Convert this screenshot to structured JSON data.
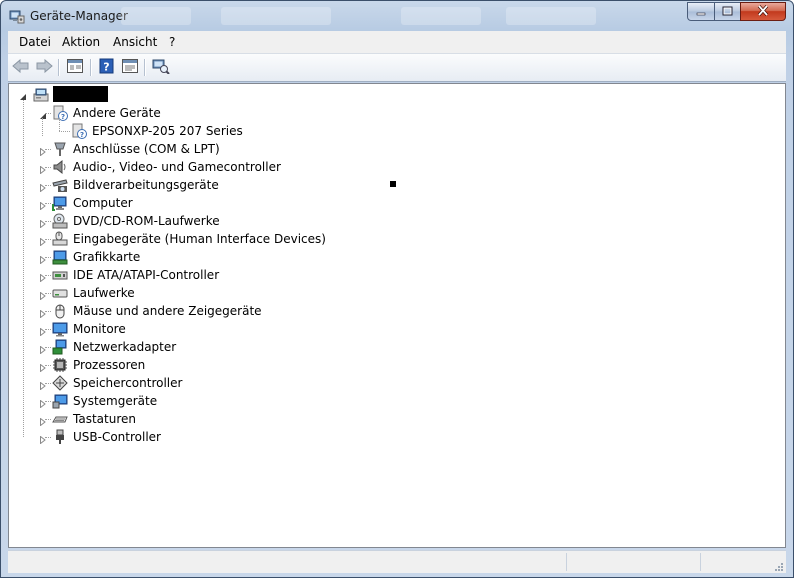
{
  "window": {
    "title": "Geräte-Manager",
    "controls": [
      "minimize",
      "maximize",
      "close"
    ]
  },
  "menu": [
    {
      "label": "Datei"
    },
    {
      "label": "Aktion"
    },
    {
      "label": "Ansicht"
    },
    {
      "label": "?"
    }
  ],
  "toolbar": {
    "buttons": [
      "back-icon",
      "forward-icon",
      "properties-view-icon",
      "help-icon",
      "show-hidden-icon",
      "scan-hardware-icon"
    ]
  },
  "tree": {
    "root": {
      "label": "",
      "icon": "computer-root-icon",
      "expanded": true
    },
    "categories": [
      {
        "label": "Andere Geräte",
        "icon": "unknown-device-icon",
        "expanded": true,
        "children": [
          {
            "label": "EPSONXP-205 207 Series",
            "icon": "unknown-device-icon"
          }
        ]
      },
      {
        "label": "Anschlüsse (COM & LPT)",
        "icon": "port-icon"
      },
      {
        "label": "Audio-, Video- und Gamecontroller",
        "icon": "speaker-icon"
      },
      {
        "label": "Bildverarbeitungsgeräte",
        "icon": "camera-icon"
      },
      {
        "label": "Computer",
        "icon": "computer-icon"
      },
      {
        "label": "DVD/CD-ROM-Laufwerke",
        "icon": "dvd-drive-icon"
      },
      {
        "label": "Eingabegeräte (Human Interface Devices)",
        "icon": "hid-icon"
      },
      {
        "label": "Grafikkarte",
        "icon": "display-adapter-icon"
      },
      {
        "label": "IDE ATA/ATAPI-Controller",
        "icon": "ide-controller-icon"
      },
      {
        "label": "Laufwerke",
        "icon": "disk-drive-icon"
      },
      {
        "label": "Mäuse und andere Zeigegeräte",
        "icon": "mouse-icon"
      },
      {
        "label": "Monitore",
        "icon": "monitor-icon"
      },
      {
        "label": "Netzwerkadapter",
        "icon": "network-adapter-icon"
      },
      {
        "label": "Prozessoren",
        "icon": "processor-icon"
      },
      {
        "label": "Speichercontroller",
        "icon": "storage-controller-icon"
      },
      {
        "label": "Systemgeräte",
        "icon": "system-devices-icon"
      },
      {
        "label": "Tastaturen",
        "icon": "keyboard-icon"
      },
      {
        "label": "USB-Controller",
        "icon": "usb-icon"
      }
    ]
  },
  "status_bar": {
    "text": ""
  },
  "colors": {
    "frame": "#bfd0e6",
    "tree_background": "#ffffff",
    "close_button": "#c2391d"
  }
}
